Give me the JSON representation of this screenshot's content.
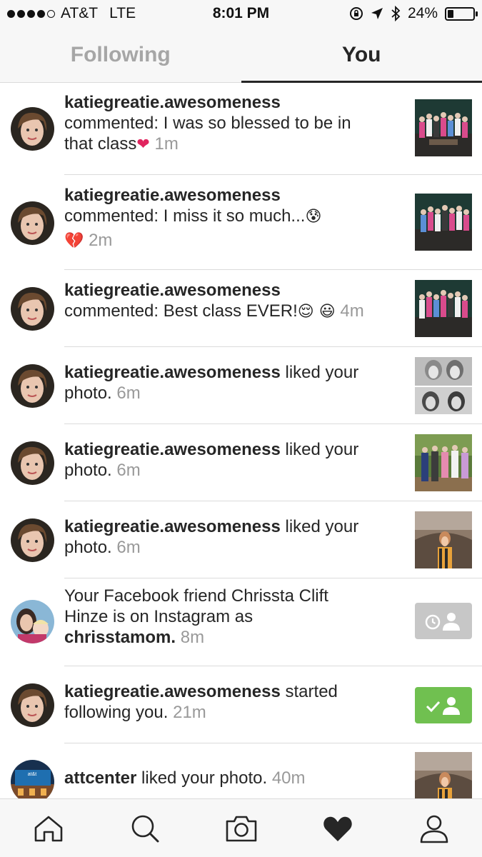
{
  "status_bar": {
    "carrier": "AT&T",
    "network": "LTE",
    "time": "8:01 PM",
    "battery_percent_label": "24%",
    "battery_level": 0.24
  },
  "tabs": [
    {
      "label": "Following",
      "active": false
    },
    {
      "label": "You",
      "active": true
    }
  ],
  "activity": [
    {
      "user": "katiegreatie.awesomeness",
      "line1": "commented: I was so blessed to be in",
      "line2": "that class",
      "emoji": "❤",
      "time": "1m"
    },
    {
      "user": "katiegreatie.awesomeness",
      "line1": "commented: I miss it so much...",
      "emoji1": "😰",
      "emoji2": "💔",
      "time": "2m"
    },
    {
      "user": "katiegreatie.awesomeness",
      "line1": "commented: Best class EVER!",
      "emoji": "😌 😃",
      "time": "4m"
    },
    {
      "user": "katiegreatie.awesomeness",
      "action": "liked your",
      "line2": "photo.",
      "time": "6m"
    },
    {
      "user": "katiegreatie.awesomeness",
      "action": "liked your",
      "line2": "photo.",
      "time": "6m"
    },
    {
      "user": "katiegreatie.awesomeness",
      "action": "liked your",
      "line2": "photo.",
      "time": "6m"
    },
    {
      "line1": "Your Facebook friend Chrissta Clift",
      "line2": "Hinze is on Instagram as",
      "user": "chrisstamom.",
      "time": "8m"
    },
    {
      "user": "katiegreatie.awesomeness",
      "action": "started",
      "line2": "following you.",
      "time": "21m"
    },
    {
      "user": "attcenter",
      "action": "liked your photo.",
      "time": "40m"
    }
  ],
  "icons": {
    "nav": [
      "home-icon",
      "search-icon",
      "camera-icon",
      "heart-icon",
      "profile-icon"
    ],
    "follow_pending": "clock-person-icon",
    "follow_done": "check-person-icon"
  },
  "colors": {
    "following_green": "#70c050",
    "pending_gray": "#c7c7c7",
    "secondary_text": "#999999"
  }
}
